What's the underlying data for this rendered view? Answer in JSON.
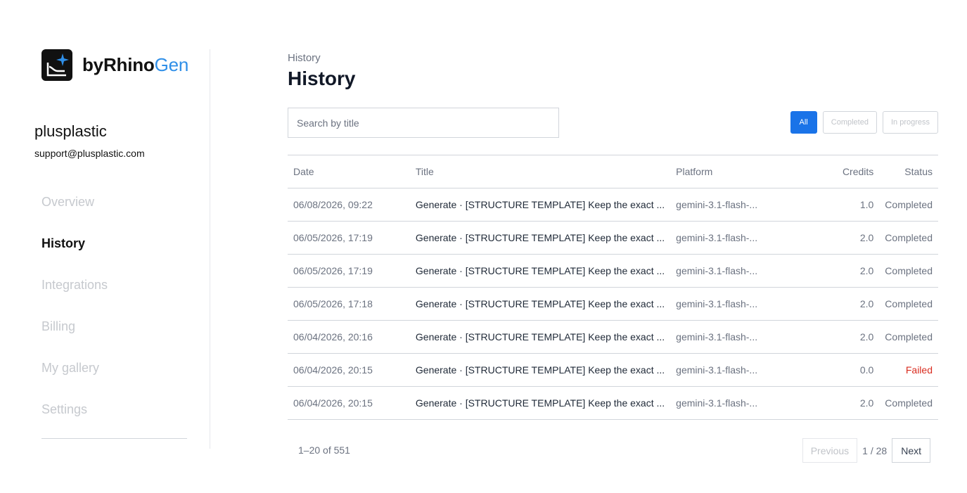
{
  "brand": {
    "name_main": "byRhino",
    "name_accent": "Gen",
    "accent_color": "#2f8fe8"
  },
  "account": {
    "name": "plusplastic",
    "email": "support@plusplastic.com"
  },
  "sidebar": {
    "items": [
      {
        "label": "Overview",
        "active": false
      },
      {
        "label": "History",
        "active": true
      },
      {
        "label": "Integrations",
        "active": false
      },
      {
        "label": "Billing",
        "active": false
      },
      {
        "label": "My gallery",
        "active": false
      },
      {
        "label": "Settings",
        "active": false
      }
    ]
  },
  "header": {
    "breadcrumb": "History",
    "title": "History"
  },
  "search": {
    "placeholder": "Search by title",
    "value": ""
  },
  "filters": {
    "all": "All",
    "completed": "Completed",
    "in_progress": "In progress",
    "active_color": "#1a73e8"
  },
  "table": {
    "headers": {
      "date": "Date",
      "title": "Title",
      "platform": "Platform",
      "credits": "Credits",
      "status": "Status"
    },
    "rows": [
      {
        "date": "06/08/2026, 09:22",
        "title": "Generate · [STRUCTURE TEMPLATE] Keep the exact ...",
        "platform": "gemini-3.1-flash-...",
        "credits": "1.0",
        "status": "Completed"
      },
      {
        "date": "06/05/2026, 17:19",
        "title": "Generate · [STRUCTURE TEMPLATE] Keep the exact ...",
        "platform": "gemini-3.1-flash-...",
        "credits": "2.0",
        "status": "Completed"
      },
      {
        "date": "06/05/2026, 17:19",
        "title": "Generate · [STRUCTURE TEMPLATE] Keep the exact ...",
        "platform": "gemini-3.1-flash-...",
        "credits": "2.0",
        "status": "Completed"
      },
      {
        "date": "06/05/2026, 17:18",
        "title": "Generate · [STRUCTURE TEMPLATE] Keep the exact ...",
        "platform": "gemini-3.1-flash-...",
        "credits": "2.0",
        "status": "Completed"
      },
      {
        "date": "06/04/2026, 20:16",
        "title": "Generate · [STRUCTURE TEMPLATE] Keep the exact ...",
        "platform": "gemini-3.1-flash-...",
        "credits": "2.0",
        "status": "Completed"
      },
      {
        "date": "06/04/2026, 20:15",
        "title": "Generate · [STRUCTURE TEMPLATE] Keep the exact ...",
        "platform": "gemini-3.1-flash-...",
        "credits": "0.0",
        "status": "Failed"
      },
      {
        "date": "06/04/2026, 20:15",
        "title": "Generate · [STRUCTURE TEMPLATE] Keep the exact ...",
        "platform": "gemini-3.1-flash-...",
        "credits": "2.0",
        "status": "Completed"
      }
    ]
  },
  "pagination": {
    "range": "1–20 of 551",
    "previous": "Previous",
    "page": "1 / 28",
    "next": "Next"
  },
  "status_colors": {
    "failed": "#d92d20"
  }
}
